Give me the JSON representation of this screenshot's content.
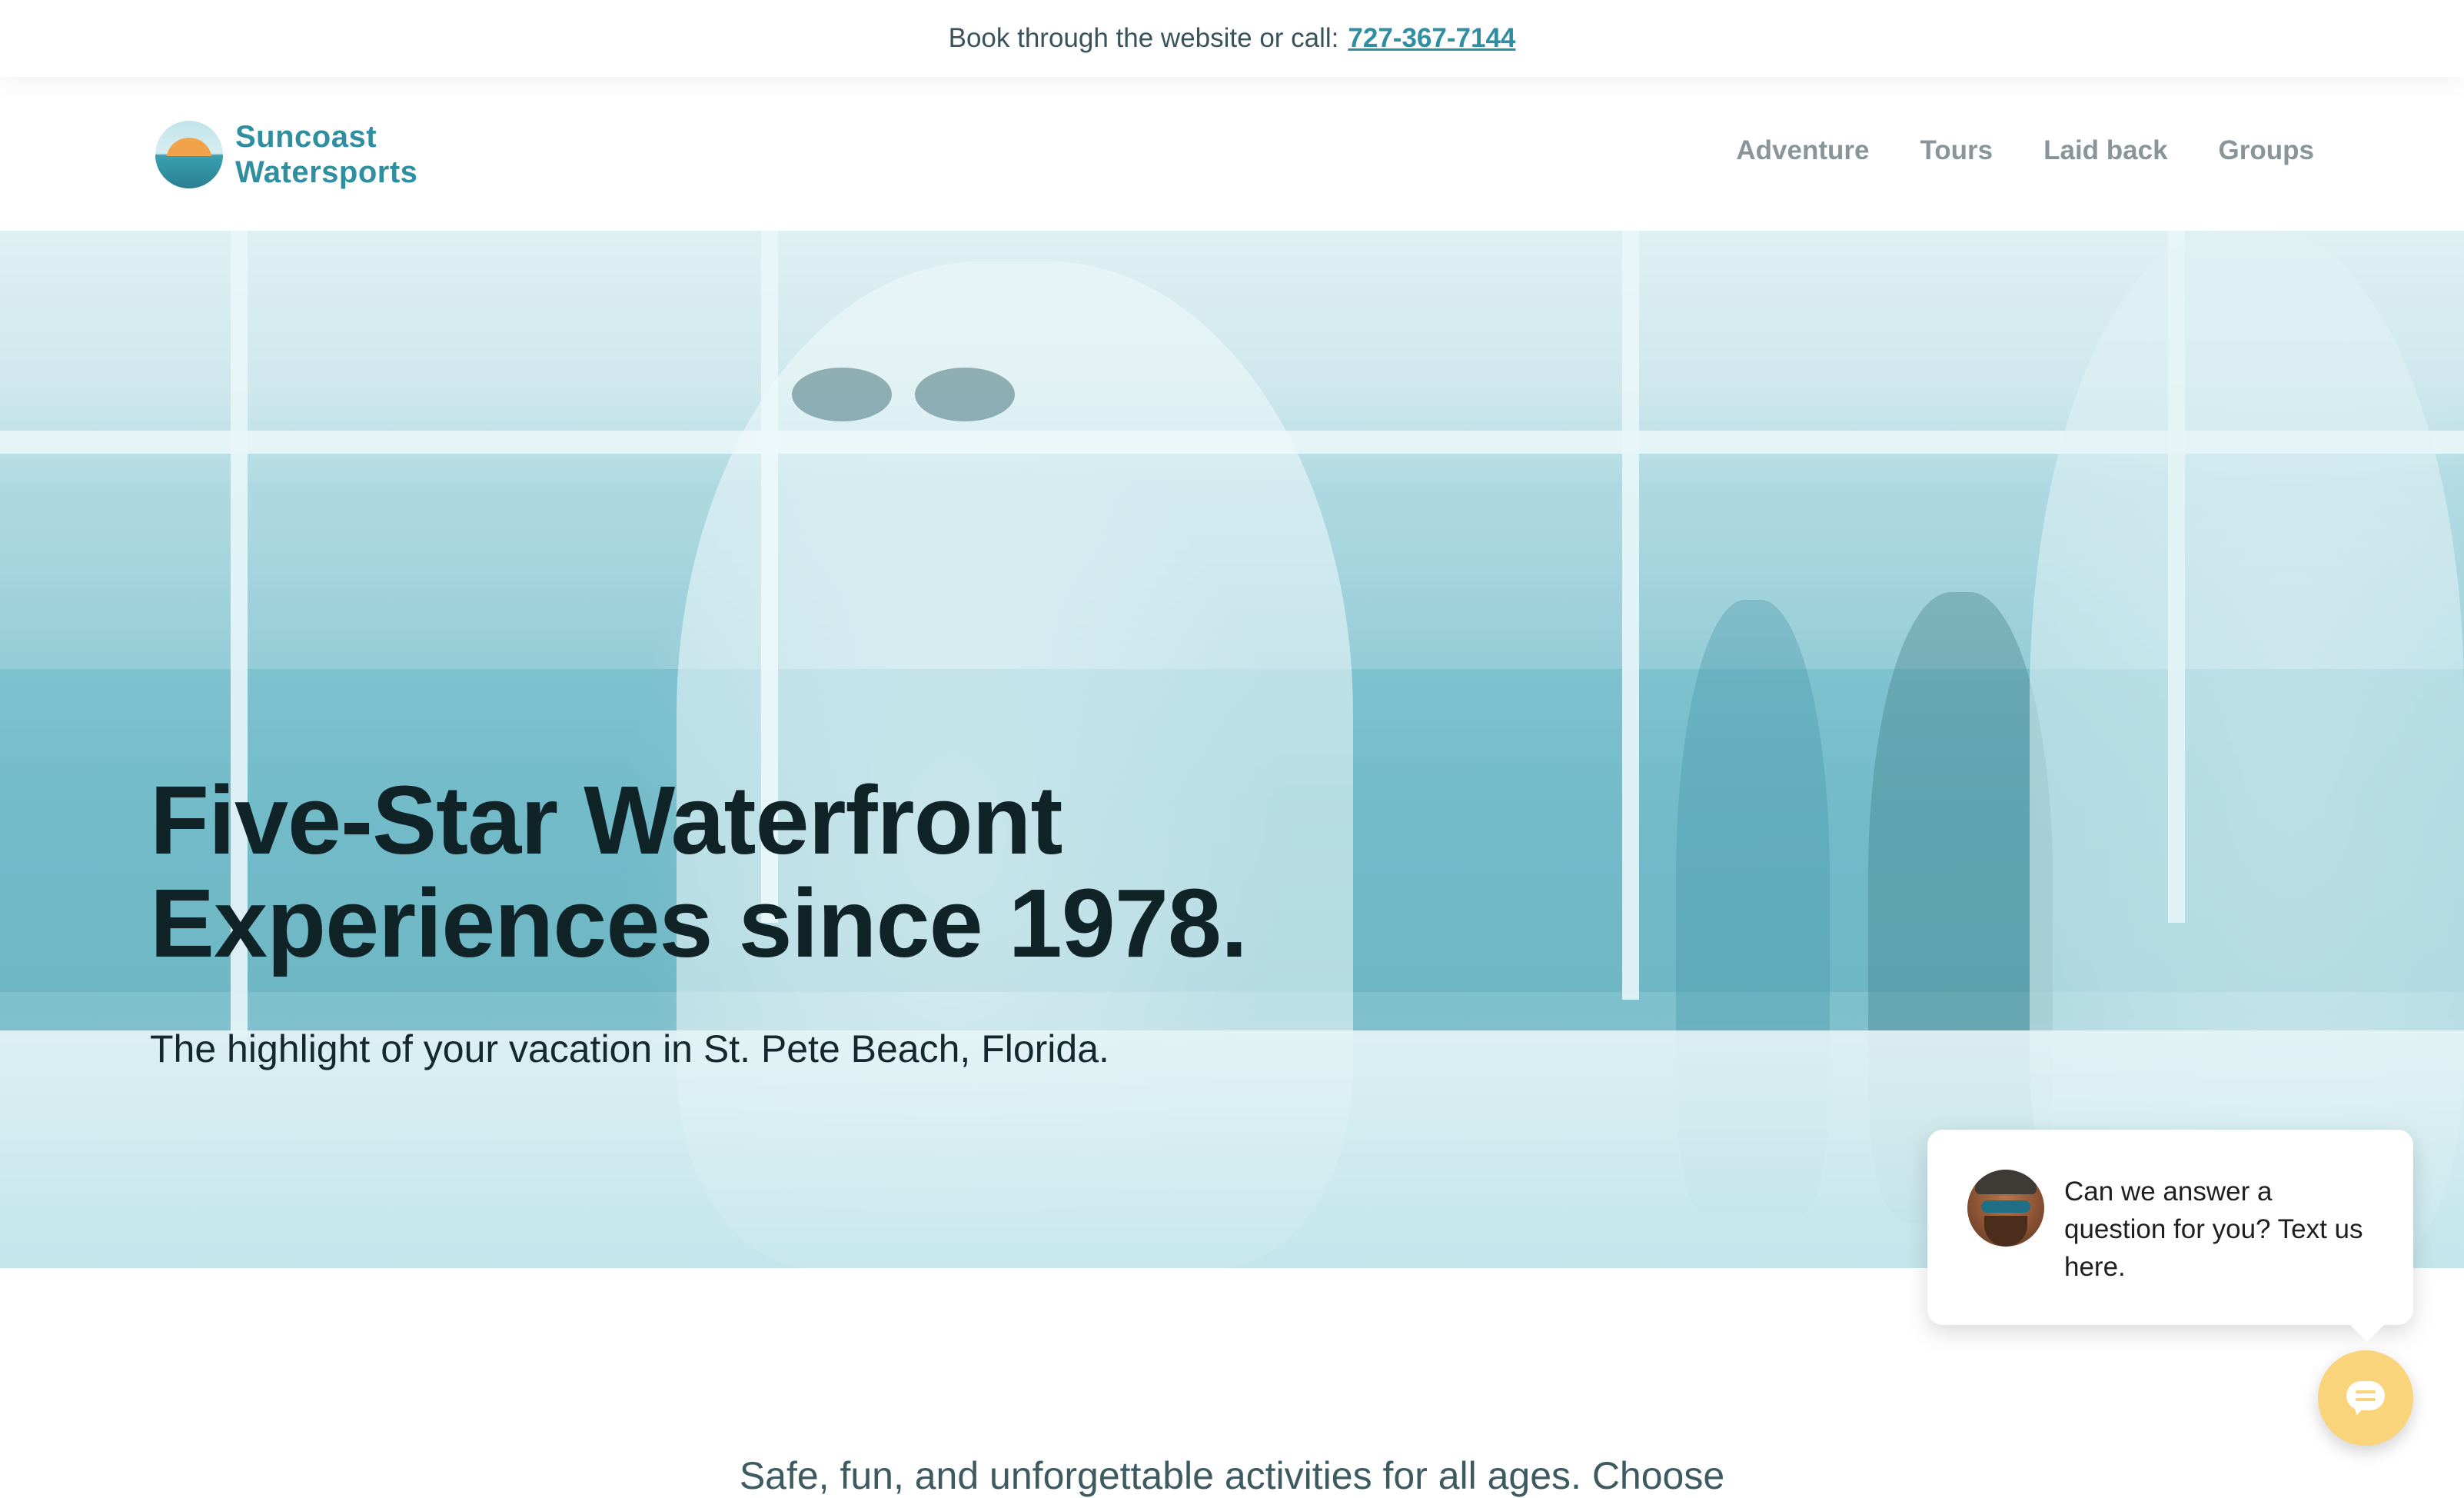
{
  "topbar": {
    "text": "Book through the website or call:",
    "phone": "727-367-7144"
  },
  "header": {
    "logo": {
      "line1": "Suncoast",
      "line2": "Watersports"
    },
    "nav": [
      {
        "label": "Adventure"
      },
      {
        "label": "Tours"
      },
      {
        "label": "Laid back"
      },
      {
        "label": "Groups"
      }
    ]
  },
  "hero": {
    "title": "Five-Star Waterfront\nExperiences since 1978.",
    "subtitle": "The highlight of your vacation in St. Pete Beach, Florida."
  },
  "chat": {
    "message": "Can we answer a question for you? Text us here.",
    "icon": "chat-bubble-icon"
  },
  "intro": {
    "text": "Safe, fun, and unforgettable activities for all ages. Choose"
  },
  "colors": {
    "brand_teal": "#2f8ea0",
    "nav_gray": "#8a9599",
    "chat_yellow": "#f9d47a",
    "hero_title": "#102428"
  }
}
